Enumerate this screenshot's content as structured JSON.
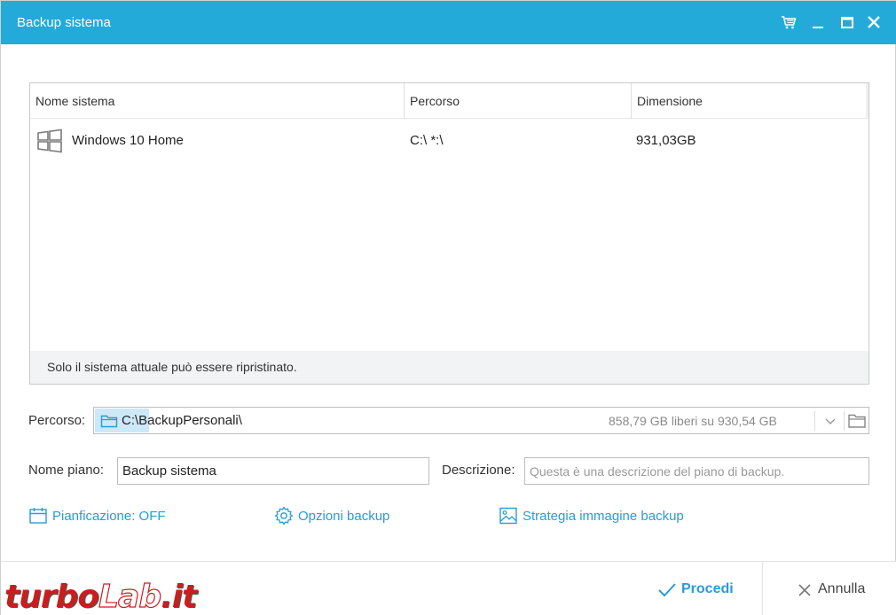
{
  "window": {
    "title": "Backup sistema",
    "accent_color": "#24aad9",
    "titlebar_icons": [
      "cart-icon",
      "minimize-icon",
      "maximize-icon",
      "close-icon"
    ]
  },
  "table": {
    "columns": [
      "Nome sistema",
      "Percorso",
      "Dimensione"
    ],
    "rows": [
      {
        "icon": "windows-icon",
        "name": "Windows 10 Home",
        "path": "C:\\ *:\\",
        "size": "931,03GB"
      }
    ],
    "footer_note": "Solo il sistema attuale può essere ripristinato."
  },
  "destination": {
    "label": "Percorso:",
    "value": "C:\\BackupPersonali\\",
    "free_space": "858,79 GB liberi su 930,54 GB"
  },
  "plan": {
    "name_label": "Nome piano:",
    "name_value": "Backup sistema",
    "desc_label": "Descrizione:",
    "desc_placeholder": "Questa è una descrizione del piano di backup."
  },
  "options": {
    "schedule": "Pianficazione: OFF",
    "backup_options": "Opzioni backup",
    "image_strategy": "Strategia immagine backup"
  },
  "footer": {
    "proceed": "Procedi",
    "cancel": "Annulla"
  },
  "watermark": {
    "part1": "turbo",
    "part2": "Lab",
    "part3": ".it"
  }
}
